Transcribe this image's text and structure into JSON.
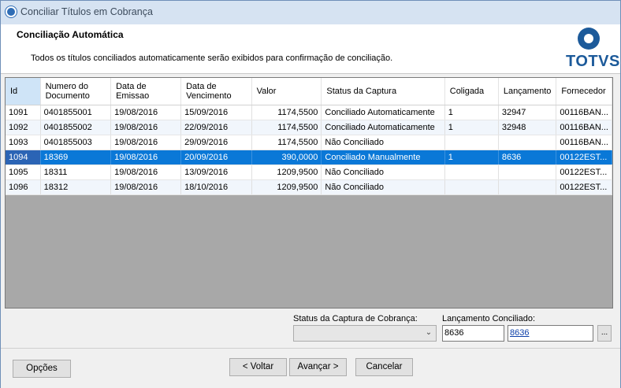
{
  "window": {
    "title": "Conciliar Títulos em Cobrança"
  },
  "header": {
    "title": "Conciliação Automática",
    "description": "Todos os títulos conciliados automaticamente serão exibidos para confirmação de conciliação.",
    "logo_text": "TOTVS"
  },
  "grid": {
    "columns": [
      {
        "label": "Id"
      },
      {
        "label": "Numero do Documento"
      },
      {
        "label": "Data de Emissao"
      },
      {
        "label": "Data de Vencimento"
      },
      {
        "label": "Valor"
      },
      {
        "label": "Status da Captura"
      },
      {
        "label": "Coligada"
      },
      {
        "label": "Lançamento"
      },
      {
        "label": "Fornecedor"
      }
    ],
    "rows": [
      {
        "id": "1091",
        "documento": "0401855001",
        "emissao": "19/08/2016",
        "vencimento": "15/09/2016",
        "valor": "1174,5500",
        "status": "Conciliado Automaticamente",
        "coligada": "1",
        "lancamento": "32947",
        "fornecedor": "00116BAN..."
      },
      {
        "id": "1092",
        "documento": "0401855002",
        "emissao": "19/08/2016",
        "vencimento": "22/09/2016",
        "valor": "1174,5500",
        "status": "Conciliado Automaticamente",
        "coligada": "1",
        "lancamento": "32948",
        "fornecedor": "00116BAN..."
      },
      {
        "id": "1093",
        "documento": "0401855003",
        "emissao": "19/08/2016",
        "vencimento": "29/09/2016",
        "valor": "1174,5500",
        "status": "Não Conciliado",
        "coligada": "",
        "lancamento": "",
        "fornecedor": "00116BAN..."
      },
      {
        "id": "1094",
        "documento": "18369",
        "emissao": "19/08/2016",
        "vencimento": "20/09/2016",
        "valor": "390,0000",
        "status": "Conciliado Manualmente",
        "coligada": "1",
        "lancamento": "8636",
        "fornecedor": "00122EST...",
        "selected": true
      },
      {
        "id": "1095",
        "documento": "18311",
        "emissao": "19/08/2016",
        "vencimento": "13/09/2016",
        "valor": "1209,9500",
        "status": "Não Conciliado",
        "coligada": "",
        "lancamento": "",
        "fornecedor": "00122EST..."
      },
      {
        "id": "1096",
        "documento": "18312",
        "emissao": "19/08/2016",
        "vencimento": "18/10/2016",
        "valor": "1209,9500",
        "status": "Não Conciliado",
        "coligada": "",
        "lancamento": "",
        "fornecedor": "00122EST..."
      }
    ]
  },
  "form": {
    "status_label": "Status da Captura de Cobrança:",
    "status_value": "",
    "lancamento_label": "Lançamento Conciliado:",
    "lancamento_code": "8636",
    "lancamento_link": "8636",
    "lookup_label": "..."
  },
  "footer": {
    "options_label": "Opções",
    "back_label": "< Voltar",
    "next_label": "Avançar >",
    "cancel_label": "Cancelar"
  },
  "colors": {
    "selection": "#0a78d7",
    "brand": "#1c5a9a"
  },
  "icons": {
    "window": "totvs-app-icon",
    "dropdown": "chevron-down-icon"
  }
}
